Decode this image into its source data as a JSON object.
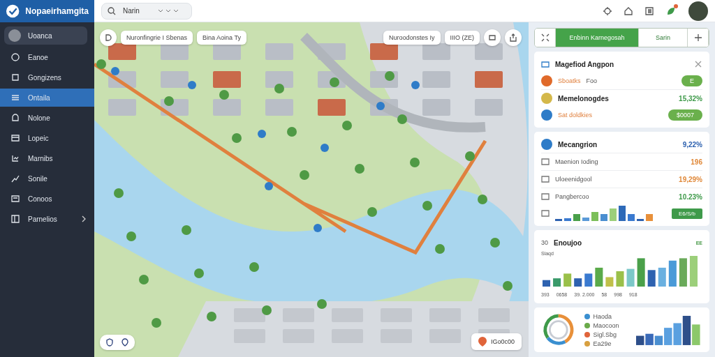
{
  "app": {
    "title": "Nopaeirhamgita"
  },
  "search": {
    "value": "Narin"
  },
  "header": {
    "notification": true
  },
  "sidebar": {
    "user": "Uoanca",
    "items": [
      {
        "label": "Eanoe",
        "selected": false,
        "has_submenu": false
      },
      {
        "label": "Gongizens",
        "selected": false,
        "has_submenu": false
      },
      {
        "label": "Ontaila",
        "selected": true,
        "has_submenu": false
      },
      {
        "label": "Nolone",
        "selected": false,
        "has_submenu": false
      },
      {
        "label": "Lopeic",
        "selected": false,
        "has_submenu": false
      },
      {
        "label": "Marnibs",
        "selected": false,
        "has_submenu": false
      },
      {
        "label": "Sonile",
        "selected": false,
        "has_submenu": false
      },
      {
        "label": "Conoos",
        "selected": false,
        "has_submenu": false
      },
      {
        "label": "Parnelios",
        "selected": false,
        "has_submenu": true
      }
    ]
  },
  "map": {
    "chips_left": [
      "Nuronfingrie I Sbenas",
      "Bina Aoina Ty"
    ],
    "chips_right": [
      "Nuroodonstes  Iy",
      "IIIO  (ZE)"
    ],
    "location_badge": "IGo0c00"
  },
  "panel": {
    "tabs": [
      {
        "label": "Enbinn Karnegosah",
        "selected": true
      },
      {
        "label": "Sarin",
        "selected": false
      }
    ],
    "card1": {
      "title": "Magefiod Angpon",
      "rows": [
        {
          "label": "Sboatks",
          "note": "Foo",
          "badge": "E",
          "color": "#e06a2a"
        },
        {
          "label": "Memelonogdes",
          "value": "15,32%",
          "color": "#d4b84a"
        },
        {
          "label": "Sat doldkies",
          "badge": "$0007",
          "color": "#2e7cc8"
        }
      ]
    },
    "card2": {
      "title": "Mecangrion",
      "value": "9,22%",
      "rows": [
        {
          "label": "Maenion Ioding",
          "value": "196",
          "color": "#e0893a"
        },
        {
          "label": "Uloeenidgool",
          "value": "19,29%",
          "color": "#e0893a"
        },
        {
          "label": "Pangbercoo",
          "value": "10.23%",
          "color": "#3f9a4a"
        }
      ],
      "badge": "E6/S/b"
    },
    "card3": {
      "axis_label": "30",
      "title": "Enoujoo",
      "tag": "EE",
      "legend": "Slaqd",
      "x_labels": [
        "393",
        "0658",
        "39. 2.000",
        "58",
        "998",
        "918"
      ]
    },
    "card4": {
      "legend": [
        {
          "label": "Haoda",
          "color": "#3a8fd0"
        },
        {
          "label": "Maocoon",
          "color": "#6aaa4a"
        },
        {
          "label": "Sigl.Sbg",
          "color": "#e0643a"
        },
        {
          "label": "Ea29e",
          "color": "#d8a040"
        }
      ]
    }
  }
}
